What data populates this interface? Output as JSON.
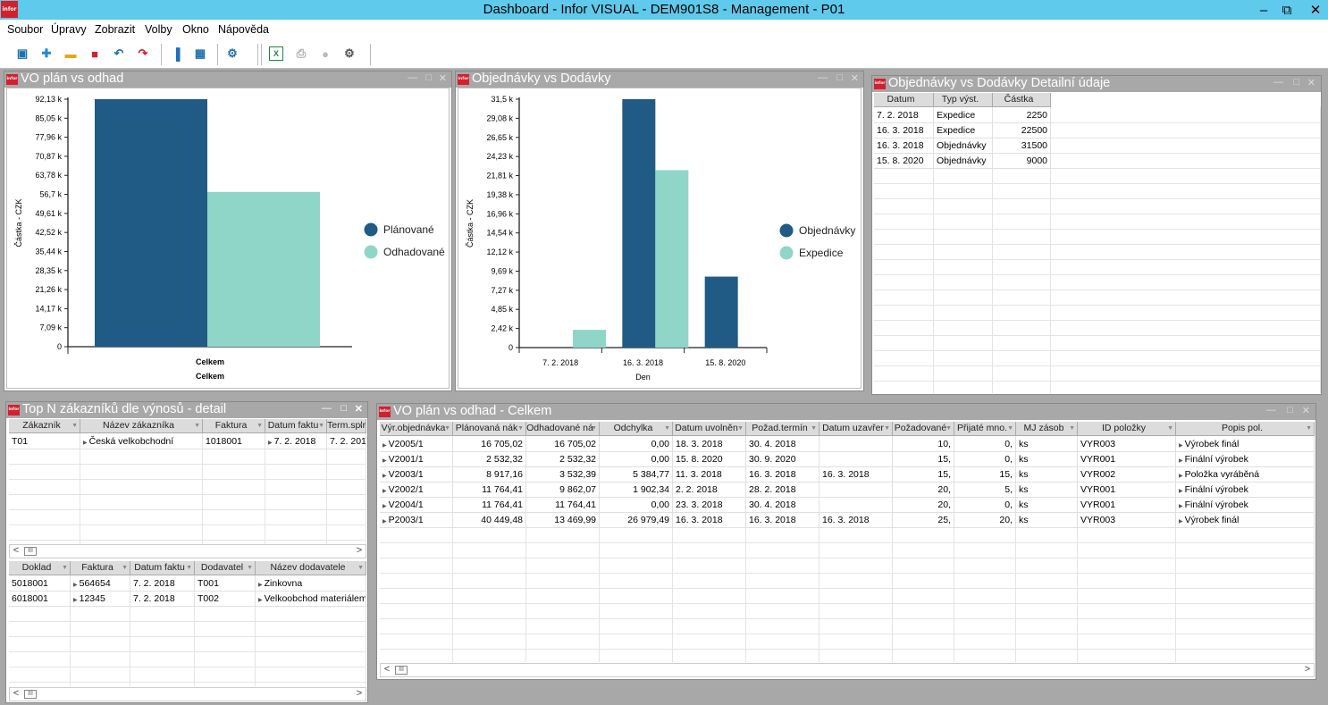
{
  "window": {
    "title": "Dashboard - Infor VISUAL - DEM901S8 - Management - P01",
    "logo": "infor",
    "controls": [
      "minimize-icon",
      "restore-icon",
      "close-icon"
    ]
  },
  "menu": [
    "Soubor",
    "Úpravy",
    "Zobrazit",
    "Volby",
    "Okno",
    "Nápověda"
  ],
  "toolbar": [
    "save-icon",
    "new-icon",
    "open-folder-icon",
    "delete-icon",
    "undo-icon",
    "redo-icon",
    "chart-icon",
    "table-grid-icon",
    "settings-gear-icon",
    "excel-icon",
    "print-icon",
    "info-icon",
    "gear-icon"
  ],
  "colors": {
    "dark": "#1f5b84",
    "light": "#8fd5c8",
    "titlebar": "#5fcaec",
    "panel_head": "#a8a8a8"
  },
  "panel1": {
    "title": "VO plán vs odhad"
  },
  "panel2": {
    "title": "Objednávky vs Dodávky"
  },
  "panel3": {
    "title": "Objednávky vs Dodávky Detailní údaje",
    "columns": [
      "Datum",
      "Typ výst.",
      "Částka"
    ],
    "rows": [
      [
        "7. 2. 2018",
        "Expedice",
        "2250"
      ],
      [
        "16. 3. 2018",
        "Expedice",
        "22500"
      ],
      [
        "16. 3. 2018",
        "Objednávky",
        "31500"
      ],
      [
        "15. 8. 2020",
        "Objednávky",
        "9000"
      ]
    ]
  },
  "panel4": {
    "title": "Top N zákazníků dle výnosů - detail",
    "top_columns": [
      "Zákazník",
      "Název zákazníka",
      "Faktura",
      "Datum faktu",
      "Term.splr"
    ],
    "top_rows": [
      [
        "T01",
        "Česká velkobchodní",
        "1018001",
        "7. 2. 2018",
        "7. 2. 201"
      ]
    ],
    "bottom_columns": [
      "Doklad",
      "Faktura",
      "Datum faktu",
      "Dodavatel",
      "Název dodavatele"
    ],
    "bottom_rows": [
      [
        "5018001",
        "564654",
        "7. 2. 2018",
        "T001",
        "Zinkovna"
      ],
      [
        "6018001",
        "12345",
        "7. 2. 2018",
        "T002",
        "Velkoobchod materiálem"
      ]
    ],
    "scroll_glyphs": [
      "<",
      "III",
      ">"
    ]
  },
  "panel5": {
    "title": "VO plán vs odhad - Celkem",
    "columns": [
      "Výr.objednávka",
      "Plánovaná nák",
      "Odhadované ná",
      "Odchylka",
      "Datum uvolněn",
      "Požad.termín",
      "Datum uzavřer",
      "Požadované",
      "Přijaté mno.",
      "MJ zásob",
      "ID položky",
      "Popis pol."
    ],
    "rows": [
      [
        "V2005/1",
        "16 705,02",
        "16 705,02",
        "0,00",
        "18. 3. 2018",
        "30. 4. 2018",
        "",
        "10,",
        "0,",
        "ks",
        "VYR003",
        "Výrobek finál"
      ],
      [
        "V2001/1",
        "2 532,32",
        "2 532,32",
        "0,00",
        "15. 8. 2020",
        "30. 9. 2020",
        "",
        "15,",
        "0,",
        "ks",
        "VYR001",
        "Finální výrobek"
      ],
      [
        "V2003/1",
        "8 917,16",
        "3 532,39",
        "5 384,77",
        "11. 3. 2018",
        "16. 3. 2018",
        "16. 3. 2018",
        "15,",
        "15,",
        "ks",
        "VYR002",
        "Položka vyráběná"
      ],
      [
        "V2002/1",
        "11 764,41",
        "9 862,07",
        "1 902,34",
        "2. 2. 2018",
        "28. 2. 2018",
        "",
        "20,",
        "5,",
        "ks",
        "VYR001",
        "Finální výrobek"
      ],
      [
        "V2004/1",
        "11 764,41",
        "11 764,41",
        "0,00",
        "23. 3. 2018",
        "30. 4. 2018",
        "",
        "20,",
        "0,",
        "ks",
        "VYR001",
        "Finální výrobek"
      ],
      [
        "P2003/1",
        "40 449,48",
        "13 469,99",
        "26 979,49",
        "16. 3. 2018",
        "16. 3. 2018",
        "16. 3. 2018",
        "25,",
        "20,",
        "ks",
        "VYR003",
        "Výrobek finál"
      ]
    ]
  },
  "chart_data": [
    {
      "type": "bar",
      "title": "VO plán vs odhad",
      "categories": [
        "Celkem"
      ],
      "series": [
        {
          "name": "Plánované",
          "values": [
            92130
          ]
        },
        {
          "name": "Odhadované",
          "values": [
            57600
          ]
        }
      ],
      "xlabel": "Celkem",
      "ylabel": "Částka - CZK",
      "ylim": [
        0,
        92130
      ],
      "yticks": [
        "0",
        "7,09 k",
        "14,17 k",
        "21,26 k",
        "28,35 k",
        "35,44 k",
        "42,52 k",
        "49,61 k",
        "56,7 k",
        "63,78 k",
        "70,87 k",
        "77,96 k",
        "85,05 k",
        "92,13 k"
      ],
      "legend": "right",
      "grid": false
    },
    {
      "type": "bar",
      "title": "Objednávky vs Dodávky",
      "categories": [
        "7. 2. 2018",
        "16. 3. 2018",
        "15. 8. 2020"
      ],
      "series": [
        {
          "name": "Objednávky",
          "values": [
            0,
            31500,
            9000
          ]
        },
        {
          "name": "Expedice",
          "values": [
            2250,
            22500,
            0
          ]
        }
      ],
      "xlabel": "Den",
      "ylabel": "Částka - CZK",
      "ylim": [
        0,
        31500
      ],
      "yticks": [
        "0",
        "2,42 k",
        "4,85 k",
        "7,27 k",
        "9,69 k",
        "12,12 k",
        "14,54 k",
        "16,96 k",
        "19,38 k",
        "21,81 k",
        "24,23 k",
        "26,65 k",
        "29,08 k",
        "31,5 k"
      ],
      "legend": "right",
      "grid": false
    }
  ]
}
